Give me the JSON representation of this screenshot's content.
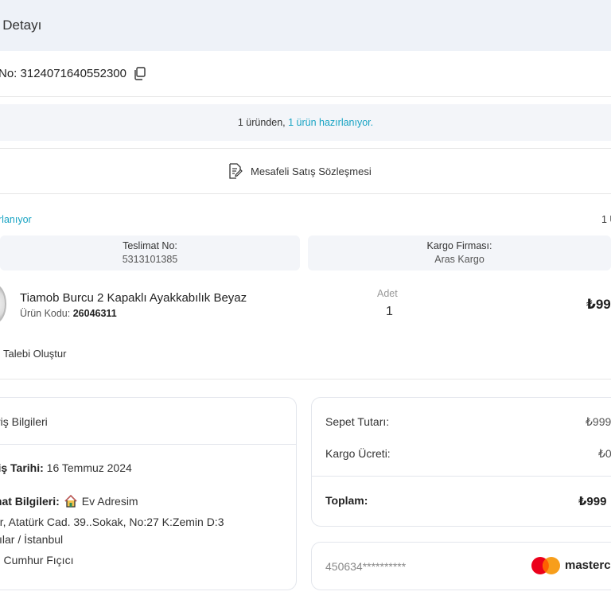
{
  "page": {
    "title": "ş Detayı"
  },
  "order": {
    "number_text": "No: 3124071640552300"
  },
  "info_banner": {
    "prefix": "1 üründen, ",
    "highlight": "1 ürün hazırlanıyor."
  },
  "contract": {
    "label": "Mesafeli Satış Sözleşmesi"
  },
  "shipment": {
    "status_left": "rlanıyor",
    "status_right": "1 Ü",
    "delivery_label": "Teslimat No:",
    "delivery_value": "5313101385",
    "cargo_label": "Kargo Firması:",
    "cargo_value": "Aras Kargo"
  },
  "product": {
    "name": "Tiamob Burcu 2 Kapaklı Ayakkabılık Beyaz",
    "code_label": "Ürün Kodu: ",
    "code_value": "26046311",
    "qty_label": "Adet",
    "qty_value": "1",
    "price": "₺99"
  },
  "return_link": "Talebi Oluştur",
  "order_info": {
    "title": "riş Bilgileri",
    "date_label": "riş Tarihi:",
    "date_value": " 16 Temmuz 2024",
    "address_label": "mat Bilgileri:",
    "address_name": "Ev Adresim",
    "address_line1": "ar, Atatürk Cad. 39..Sokak, No:27 K:Zemin D:3",
    "address_line2": "cılar / İstanbul",
    "recipient_label": ":",
    "recipient_value": " Cumhur Fıçıcı"
  },
  "summary": {
    "cart_label": "Sepet Tutarı:",
    "cart_value": "₺999",
    "shipping_label": "Kargo Ücreti:",
    "shipping_value": "₺0",
    "total_label": "Toplam:",
    "total_value": "₺999"
  },
  "payment": {
    "card_number": "450634**********",
    "brand": "masterc"
  },
  "colors": {
    "accent": "#17a3c3",
    "banner_bg": "#f3f5f9",
    "header_bg": "#eef2f8"
  },
  "icons": [
    "copy-icon",
    "document-edit-icon",
    "house-icon",
    "mastercard-logo"
  ]
}
